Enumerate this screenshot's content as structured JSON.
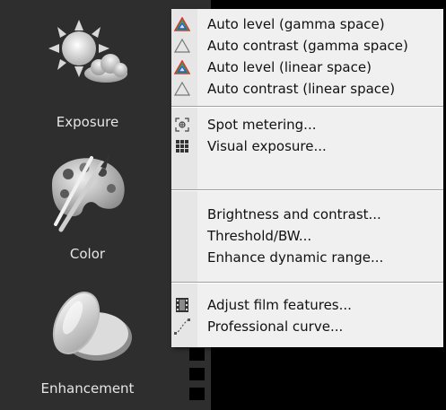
{
  "sidebar": {
    "items": [
      {
        "label": "Exposure",
        "icon": "sun-cloud-icon"
      },
      {
        "label": "Color",
        "icon": "palette-icon"
      },
      {
        "label": "Enhancement",
        "icon": "lens-icon"
      }
    ]
  },
  "menu": {
    "groups": [
      [
        {
          "label": "Auto level (gamma space)",
          "icon": "rgb-triangle-icon"
        },
        {
          "label": "Auto contrast (gamma space)",
          "icon": "gray-triangle-icon"
        },
        {
          "label": "Auto level (linear space)",
          "icon": "rgb-triangle-icon"
        },
        {
          "label": "Auto contrast (linear space)",
          "icon": "gray-triangle-icon"
        }
      ],
      [
        {
          "label": "Spot metering...",
          "icon": "spot-metering-icon"
        },
        {
          "label": "Visual exposure...",
          "icon": "grid-icon"
        }
      ],
      [
        {
          "label": "Brightness and contrast...",
          "icon": ""
        },
        {
          "label": "Threshold/BW...",
          "icon": ""
        },
        {
          "label": "Enhance dynamic range...",
          "icon": ""
        }
      ],
      [
        {
          "label": "Adjust film features...",
          "icon": "film-icon"
        },
        {
          "label": "Professional curve...",
          "icon": "curve-icon"
        }
      ]
    ]
  }
}
